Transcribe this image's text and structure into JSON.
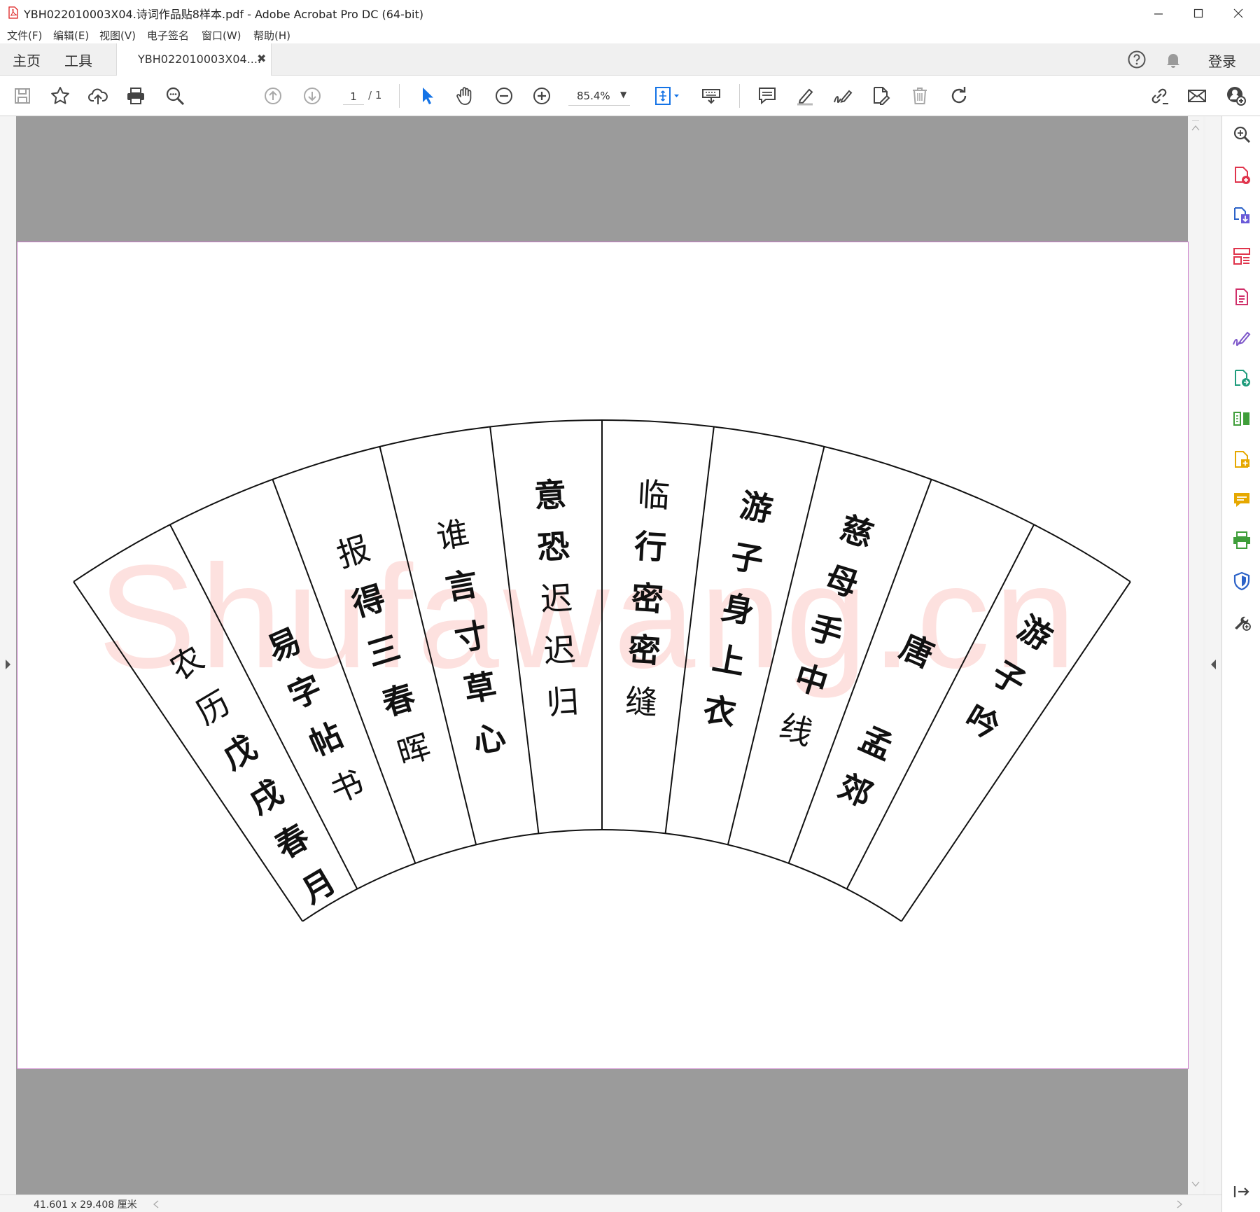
{
  "window": {
    "title": "YBH022010003X04.诗词作品贴8样本.pdf - Adobe Acrobat Pro DC (64-bit)",
    "minimize": "─",
    "maximize": "☐",
    "close": "✕"
  },
  "menu": [
    "文件(F)",
    "编辑(E)",
    "视图(V)",
    "电子签名",
    "窗口(W)",
    "帮助(H)"
  ],
  "tabs": {
    "home": "主页",
    "tools": "工具",
    "document": "YBH022010003X04....",
    "close": "✖",
    "sign_in": "登录"
  },
  "toolbar": {
    "page_current": "1",
    "page_total": "/ 1",
    "zoom": "85.4%",
    "zoom_arrow": "▼"
  },
  "status": {
    "page_size": "41.601 x 29.408 厘米"
  },
  "watermark": "Shufawang.cn",
  "fan": {
    "columns": [
      {
        "chars": [
          "农",
          "历",
          "戊",
          "戌",
          "春",
          "月"
        ],
        "bold": [
          false,
          false,
          true,
          true,
          true,
          true
        ]
      },
      {
        "chars": [
          "易",
          "字",
          "帖",
          "书"
        ],
        "bold": [
          true,
          true,
          true,
          false
        ]
      },
      {
        "chars": [
          "报",
          "得",
          "三",
          "春",
          "晖"
        ],
        "bold": [
          false,
          true,
          true,
          true,
          false
        ]
      },
      {
        "chars": [
          "谁",
          "言",
          "寸",
          "草",
          "心"
        ],
        "bold": [
          false,
          true,
          true,
          true,
          true
        ]
      },
      {
        "chars": [
          "意",
          "恐",
          "迟",
          "迟",
          "归"
        ],
        "bold": [
          true,
          true,
          false,
          false,
          false
        ]
      },
      {
        "chars": [
          "临",
          "行",
          "密",
          "密",
          "缝"
        ],
        "bold": [
          false,
          true,
          true,
          true,
          false
        ]
      },
      {
        "chars": [
          "游",
          "子",
          "身",
          "上",
          "衣"
        ],
        "bold": [
          true,
          true,
          true,
          true,
          true
        ]
      },
      {
        "chars": [
          "慈",
          "母",
          "手",
          "中",
          "线"
        ],
        "bold": [
          true,
          true,
          true,
          true,
          false
        ]
      },
      {
        "chars": [
          "唐",
          "孟",
          "郊"
        ],
        "bold": [
          true,
          true,
          true
        ]
      },
      {
        "chars": [
          "游",
          "子",
          "吟"
        ],
        "bold": [
          true,
          true,
          true
        ]
      }
    ]
  },
  "colors": {
    "accent_blue": "#1473e6",
    "tool_red": "#e0344c",
    "tool_purple": "#7d57c9",
    "tool_green": "#3f9e3a",
    "tool_yellow": "#e6a800",
    "tool_blue": "#2d63c8"
  },
  "icons": {
    "toolbar": [
      "save-icon",
      "bookmark-star-icon",
      "upload-cloud-icon",
      "print-icon",
      "find-text-icon",
      "page-up-icon",
      "page-down-icon",
      "select-arrow-icon",
      "hand-icon",
      "zoom-out-icon",
      "zoom-in-icon",
      "fit-page-icon",
      "keyboard-icon",
      "comment-icon",
      "highlight-icon",
      "sign-icon",
      "edit-pdf-icon",
      "delete-icon",
      "rotate-icon",
      "share-link-icon",
      "email-icon",
      "add-user-icon"
    ],
    "right_pane": [
      "zoom-search-icon",
      "create-pdf-icon",
      "export-pdf-icon",
      "organize-pages-icon",
      "edit-text-icon",
      "fill-sign-icon",
      "send-track-icon",
      "compare-icon",
      "rich-media-icon",
      "comment-pane-icon",
      "print-production-icon",
      "protect-icon",
      "more-tools-icon",
      "collapse-pane-icon"
    ]
  }
}
